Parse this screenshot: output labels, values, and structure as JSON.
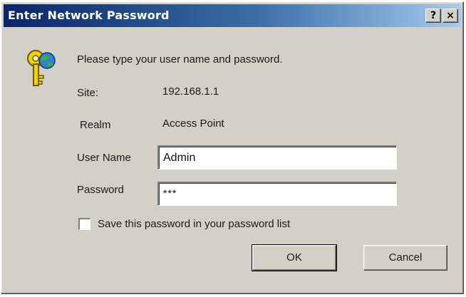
{
  "window": {
    "title": "Enter Network Password",
    "help_label": "?",
    "close_label": "×"
  },
  "prompt": "Please type your user name and password.",
  "site": {
    "label": "Site:",
    "value": "192.168.1.1"
  },
  "realm": {
    "label": "Realm",
    "value": "Access Point"
  },
  "user_name": {
    "label": "User Name",
    "value": "Admin"
  },
  "password": {
    "label": "Password",
    "value": "***"
  },
  "save_password": {
    "label": "Save this password in your password list",
    "checked": false
  },
  "buttons": {
    "ok": "OK",
    "cancel": "Cancel"
  },
  "colors": {
    "titlebar_start": "#0a246a",
    "titlebar_end": "#a6caf0",
    "dialog_bg": "#d4d0c8"
  },
  "icons": {
    "dialog_icon": "key-globe-icon"
  }
}
